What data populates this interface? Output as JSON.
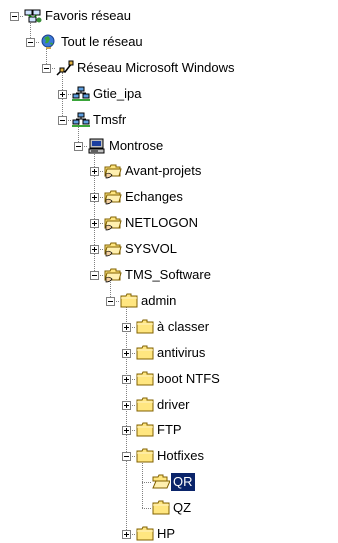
{
  "tree": {
    "nodes": [
      {
        "id": "favoris-reseau",
        "label": "Favoris réseau",
        "level": 0,
        "icon": "network-places-icon",
        "toggle": "collapse"
      },
      {
        "id": "tout-le-reseau",
        "label": "Tout le réseau",
        "level": 1,
        "icon": "globe-icon",
        "toggle": "collapse"
      },
      {
        "id": "reseau-microsoft-windows",
        "label": "Réseau Microsoft Windows",
        "level": 2,
        "icon": "network-icon",
        "toggle": "collapse"
      },
      {
        "id": "gtie-ipa",
        "label": "Gtie_ipa",
        "level": 3,
        "icon": "workgroup-icon",
        "toggle": "expand"
      },
      {
        "id": "tmsfr",
        "label": "Tmsfr",
        "level": 3,
        "icon": "workgroup-icon",
        "toggle": "collapse"
      },
      {
        "id": "montrose",
        "label": "Montrose",
        "level": 4,
        "icon": "computer-icon",
        "toggle": "collapse"
      },
      {
        "id": "avant-projets",
        "label": "Avant-projets",
        "level": 5,
        "icon": "shared-folder-icon",
        "toggle": "expand"
      },
      {
        "id": "echanges",
        "label": "Echanges",
        "level": 5,
        "icon": "shared-folder-icon",
        "toggle": "expand"
      },
      {
        "id": "netlogon",
        "label": "NETLOGON",
        "level": 5,
        "icon": "shared-folder-icon",
        "toggle": "expand"
      },
      {
        "id": "sysvol",
        "label": "SYSVOL",
        "level": 5,
        "icon": "shared-folder-icon",
        "toggle": "expand"
      },
      {
        "id": "tms-software",
        "label": "TMS_Software",
        "level": 5,
        "icon": "shared-folder-icon",
        "toggle": "collapse"
      },
      {
        "id": "admin",
        "label": "admin",
        "level": 6,
        "icon": "folder-icon",
        "toggle": "collapse"
      },
      {
        "id": "a-classer",
        "label": "à classer",
        "level": 7,
        "icon": "folder-icon",
        "toggle": "expand"
      },
      {
        "id": "antivirus",
        "label": "antivirus",
        "level": 7,
        "icon": "folder-icon",
        "toggle": "expand"
      },
      {
        "id": "boot-ntfs",
        "label": "boot NTFS",
        "level": 7,
        "icon": "folder-icon",
        "toggle": "expand"
      },
      {
        "id": "driver",
        "label": "driver",
        "level": 7,
        "icon": "folder-icon",
        "toggle": "expand"
      },
      {
        "id": "ftp",
        "label": "FTP",
        "level": 7,
        "icon": "folder-icon",
        "toggle": "expand"
      },
      {
        "id": "hotfixes",
        "label": "Hotfixes",
        "level": 7,
        "icon": "folder-icon",
        "toggle": "collapse"
      },
      {
        "id": "qr",
        "label": "QR",
        "level": 8,
        "icon": "open-folder-icon",
        "toggle": "none",
        "selected": true
      },
      {
        "id": "qz",
        "label": "QZ",
        "level": 8,
        "icon": "folder-icon",
        "toggle": "none"
      },
      {
        "id": "hp",
        "label": "HP",
        "level": 7,
        "icon": "folder-icon",
        "toggle": "expand"
      }
    ]
  },
  "colors": {
    "selection_background": "#0a246a",
    "selection_text": "#ffffff",
    "tree_lines": "#808080",
    "folder_yellow": "#ffe680"
  }
}
